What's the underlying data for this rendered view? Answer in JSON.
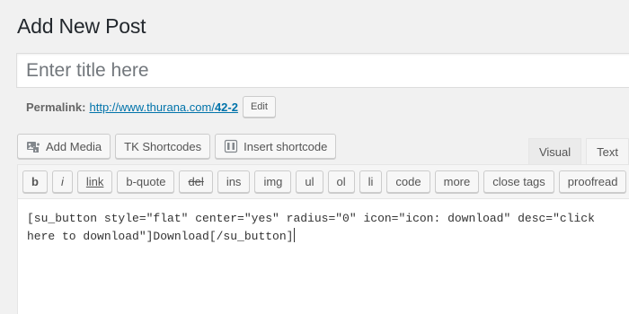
{
  "page": {
    "title": "Add New Post"
  },
  "title_input": {
    "placeholder": "Enter title here",
    "value": ""
  },
  "permalink": {
    "label": "Permalink:",
    "url_base": "http://www.thurana.com/",
    "slug": "42-2",
    "edit_label": "Edit"
  },
  "media_buttons": [
    {
      "label": "Add Media",
      "icon": "add-media-icon"
    },
    {
      "label": "TK Shortcodes"
    },
    {
      "label": "Insert shortcode",
      "icon": "shortcode-icon"
    }
  ],
  "tabs": [
    {
      "label": "Visual",
      "active": false
    },
    {
      "label": "Text",
      "active": true
    }
  ],
  "quicktags": [
    "b",
    "i",
    "link",
    "b-quote",
    "del",
    "ins",
    "img",
    "ul",
    "ol",
    "li",
    "code",
    "more",
    "close tags",
    "proofread"
  ],
  "editor": {
    "content": "[su_button style=\"flat\" center=\"yes\" radius=\"0\" icon=\"icon: download\" desc=\"click here to download\"]Download[/su_button]"
  }
}
